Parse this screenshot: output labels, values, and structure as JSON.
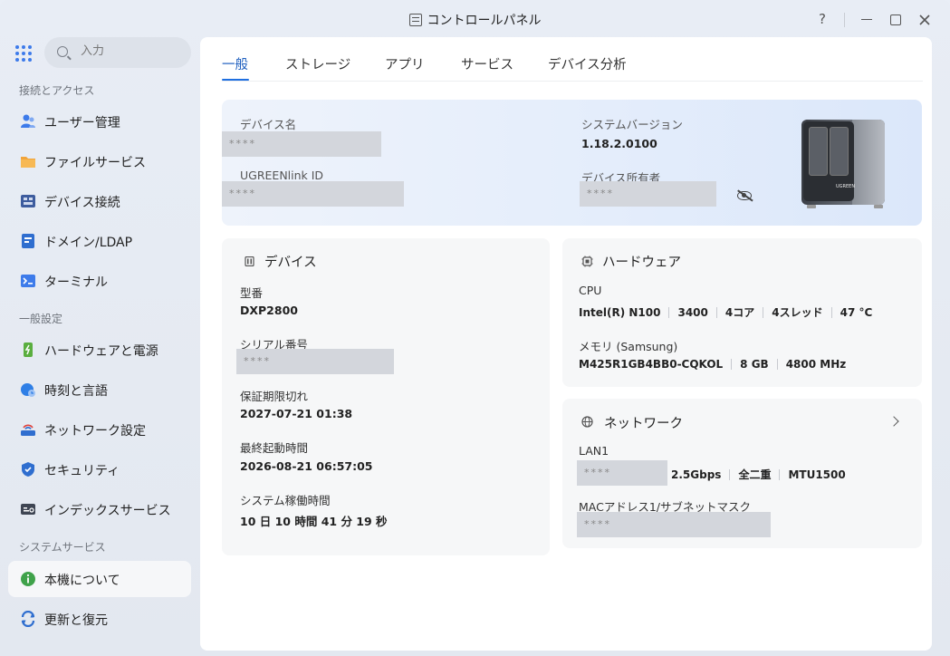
{
  "window": {
    "title": "コントロールパネル",
    "help": "?"
  },
  "search": {
    "placeholder": "入力"
  },
  "sidebar": {
    "sections": [
      {
        "label": "接続とアクセス"
      },
      {
        "label": "一般設定"
      },
      {
        "label": "システムサービス"
      }
    ],
    "items": [
      {
        "label": "ユーザー管理",
        "icon": "users-icon",
        "color": "#3d7bea"
      },
      {
        "label": "ファイルサービス",
        "icon": "folder-icon",
        "color": "#f1a43a"
      },
      {
        "label": "デバイス接続",
        "icon": "device-connect-icon",
        "color": "#3d5c9e"
      },
      {
        "label": "ドメイン/LDAP",
        "icon": "domain-icon",
        "color": "#2f6ecf"
      },
      {
        "label": "ターミナル",
        "icon": "terminal-icon",
        "color": "#3d7bea"
      },
      {
        "label": "ハードウェアと電源",
        "icon": "hardware-power-icon",
        "color": "#5aae3f"
      },
      {
        "label": "時刻と言語",
        "icon": "globe-clock-icon",
        "color": "#2f7fe6"
      },
      {
        "label": "ネットワーク設定",
        "icon": "network-settings-icon",
        "color": "#2f6ecf"
      },
      {
        "label": "セキュリティ",
        "icon": "shield-icon",
        "color": "#2f6ecf"
      },
      {
        "label": "インデックスサービス",
        "icon": "index-icon",
        "color": "#3e4553"
      },
      {
        "label": "本機について",
        "icon": "info-icon",
        "color": "#3fa24a",
        "active": true
      },
      {
        "label": "更新と復元",
        "icon": "update-restore-icon",
        "color": "#2f6ecf"
      }
    ]
  },
  "tabs": [
    {
      "label": "一般",
      "active": true
    },
    {
      "label": "ストレージ"
    },
    {
      "label": "アプリ"
    },
    {
      "label": "サービス"
    },
    {
      "label": "デバイス分析"
    }
  ],
  "hero": {
    "device_name_label": "デバイス名",
    "device_name_value": "****",
    "ugreenlink_label": "UGREENlink ID",
    "ugreenlink_value": "****",
    "system_version_label": "システムバージョン",
    "system_version_value": "1.18.2.0100",
    "owner_label": "デバイス所有者",
    "owner_value": "****",
    "nas_logo": "UGREEN"
  },
  "device_card": {
    "title": "デバイス",
    "model_label": "型番",
    "model_value": "DXP2800",
    "serial_label": "シリアル番号",
    "serial_value": "****",
    "warranty_label": "保証期限切れ",
    "warranty_value": "2027-07-21 01:38",
    "last_boot_label": "最終起動時間",
    "last_boot_value": "2026-08-21 06:57:05",
    "uptime_label": "システム稼働時間",
    "uptime_value": "10 日 10 時間 41 分 19 秒"
  },
  "hardware_card": {
    "title": "ハードウェア",
    "cpu_label": "CPU",
    "cpu_values": [
      "Intel(R) N100",
      "3400",
      "4コア",
      "4スレッド",
      "47 °C"
    ],
    "memory_label": "メモリ (Samsung)",
    "memory_values": [
      "M425R1GB4BB0-CQKOL",
      "8 GB",
      "4800 MHz"
    ]
  },
  "network_card": {
    "title": "ネットワーク",
    "lan_label": "LAN1",
    "lan_mask": "****",
    "lan_values": [
      "2.5Gbps",
      "全二重",
      "MTU1500"
    ],
    "mac_label": "MACアドレス1/サブネットマスク",
    "mac_value": "****"
  }
}
